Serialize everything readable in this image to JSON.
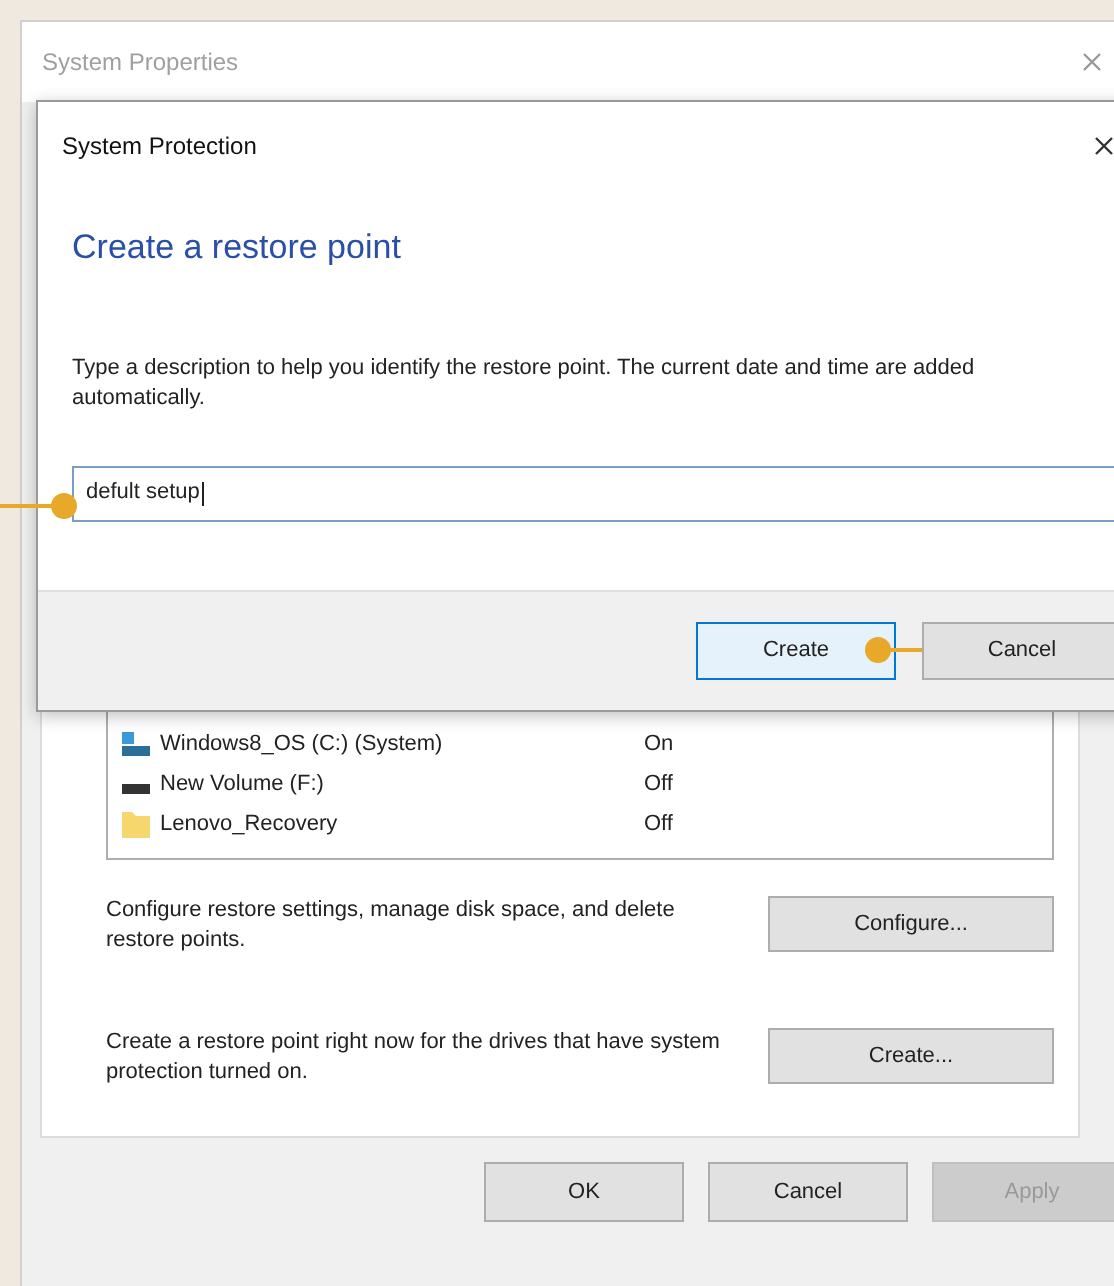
{
  "back_window": {
    "title": "System Properties",
    "drives": [
      {
        "kind": "system",
        "name": "Windows8_OS (C:) (System)",
        "protection": "On"
      },
      {
        "kind": "drive",
        "name": "New Volume (F:)",
        "protection": "Off"
      },
      {
        "kind": "folder",
        "name": "Lenovo_Recovery",
        "protection": "Off"
      }
    ],
    "actions": [
      {
        "text": "Configure restore settings, manage disk space, and delete restore points.",
        "button": "Configure..."
      },
      {
        "text": "Create a restore point right now for the drives that have system protection turned on.",
        "button": "Create..."
      }
    ],
    "buttons": [
      {
        "label": "OK",
        "disabled": false
      },
      {
        "label": "Cancel",
        "disabled": false
      },
      {
        "label": "Apply",
        "disabled": true
      }
    ]
  },
  "dialog": {
    "title": "System Protection",
    "heading": "Create a restore point",
    "description": "Type a description to help you identify the restore point. The current date and time are added automatically.",
    "input_value": "defult setup",
    "buttons": [
      {
        "label": "Create",
        "selected": true
      },
      {
        "label": "Cancel",
        "selected": false
      }
    ]
  }
}
